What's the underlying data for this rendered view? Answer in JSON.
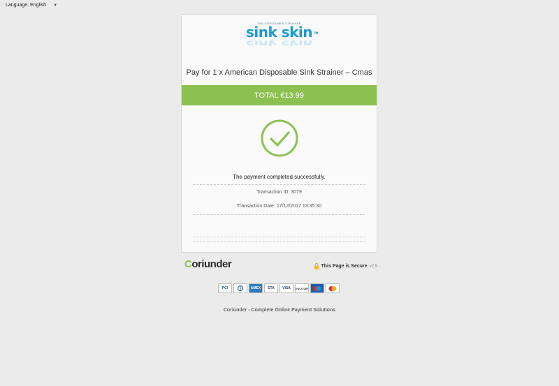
{
  "language": {
    "label": "Language:",
    "value": "English"
  },
  "brand": {
    "tagline_small": "THE DISPOSABLE STRAINER",
    "name": "sink skin",
    "tm": "TM"
  },
  "payment": {
    "title": "Pay for 1 x American Disposable Sink Strainer – Cmas",
    "total": "TOTAL €13.99",
    "message": "The payment completed successfully.",
    "transaction_id": "Transaction ID: 3079",
    "transaction_date": "Transaction Date: 17/12/2017 13:35:30"
  },
  "footer": {
    "logo": "oriunder",
    "logo_initial": "C",
    "secure_text": "This Page is Secure",
    "version": "v2.5",
    "tagline": "Coriunder - Complete Online Payment Solutions",
    "card_logos": [
      "PCI",
      "Diners Club",
      "AMEX",
      "ETA",
      "VISA",
      "DISCOVER",
      "Maestro",
      "MasterCard"
    ]
  },
  "colors": {
    "accent_green": "#8cc152",
    "brand_blue": "#1a9ad6",
    "background": "#ebebeb"
  }
}
